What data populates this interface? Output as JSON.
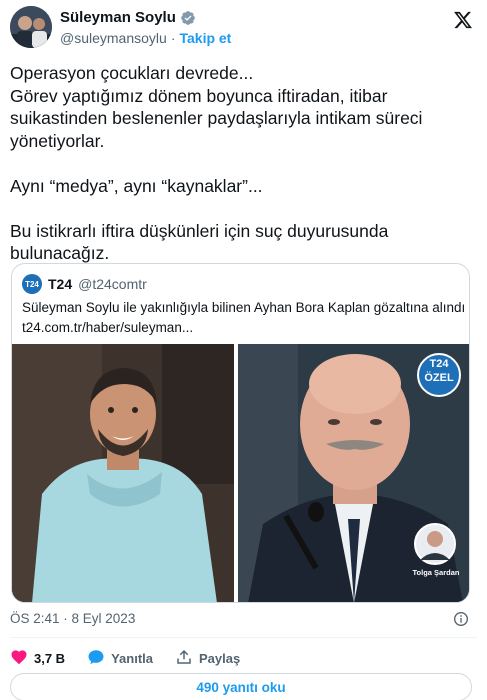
{
  "author": {
    "name": "Süleyman Soylu",
    "handle": "@suleymansoylu",
    "separator": "·",
    "follow_label": "Takip et"
  },
  "tweet": {
    "text": "Operasyon çocukları devrede...\nGörev yaptığımız dönem boyunca  iftiradan, itibar suikastinden beslenenler paydaşlarıyla intikam süreci yönetiyorlar.\n\nAynı “medya”, aynı “kaynaklar”...\n\nBu istikrarlı iftira düşkünleri için suç duyurusunda bulunacağız."
  },
  "card": {
    "logo_text": "T24",
    "name": "T24",
    "handle": "@t24comtr",
    "headline": "Süleyman Soylu ile yakınlığıyla bilinen Ayhan Bora Kaplan gözaltına alındı",
    "url": "t24.com.tr/haber/suleyman...",
    "badge_top": "T24",
    "badge_bottom": "ÖZEL",
    "byline": "Tolga Şardan"
  },
  "timestamp": "ÖS 2:41 · 8 Eyl 2023",
  "actions": {
    "likes": "3,7 B",
    "reply": "Yanıtla",
    "share": "Paylaş"
  },
  "replies_button": "490 yanıtı oku",
  "colors": {
    "accent": "#1d9bf0",
    "like": "#f91880",
    "secondary_text": "#536471"
  },
  "icons": [
    "verified-icon",
    "x-logo-icon",
    "info-icon",
    "heart-icon",
    "reply-icon",
    "share-icon"
  ]
}
